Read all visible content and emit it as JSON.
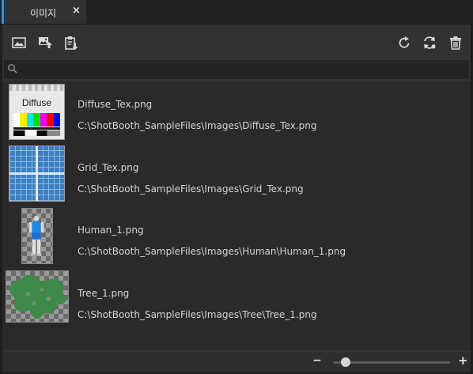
{
  "tab": {
    "title": "이미지",
    "close_symbol": "×"
  },
  "toolbar": {
    "left_icons": [
      "image-icon",
      "image-upload-icon",
      "clipboard-paste-icon"
    ],
    "right_icons": [
      "refresh-icon",
      "sync-icon",
      "trash-icon"
    ]
  },
  "search": {
    "value": "",
    "placeholder": ""
  },
  "images": [
    {
      "name": "Diffuse_Tex.png",
      "path": "C:\\ShotBooth_SampleFiles\\Images\\Diffuse_Tex.png",
      "thumb_text": "Diffuse"
    },
    {
      "name": "Grid_Tex.png",
      "path": "C:\\ShotBooth_SampleFiles\\Images\\Grid_Tex.png"
    },
    {
      "name": "Human_1.png",
      "path": "C:\\ShotBooth_SampleFiles\\Images\\Human\\Human_1.png"
    },
    {
      "name": "Tree_1.png",
      "path": "C:\\ShotBooth_SampleFiles\\Images\\Tree\\Tree_1.png"
    }
  ],
  "zoom": {
    "minus": "−",
    "plus": "+",
    "level": 0.07
  },
  "colors": {
    "accent": "#2e8fe0",
    "panel": "#323232",
    "list": "#2a2a2a"
  }
}
